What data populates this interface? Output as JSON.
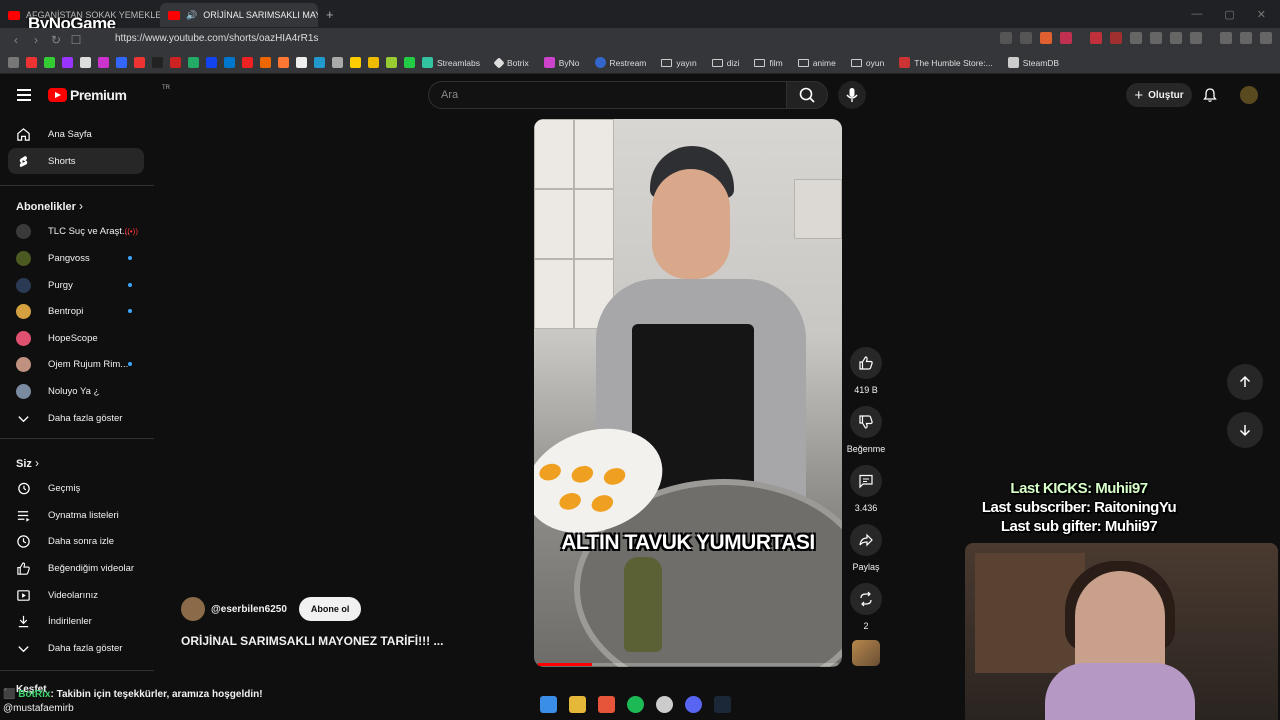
{
  "browser": {
    "tabs": [
      {
        "title": "AFGANİSTAN SOKAK YEMEKLERİNE"
      },
      {
        "title": "ORİJİNAL SARIMSAKLI MAYO"
      }
    ],
    "url": "https://www.youtube.com/shorts/oazHIA4rR1s",
    "brand_overlay": "ByNoGame",
    "bookmarks": [
      "Streamlabs",
      "Botrix",
      "ByNo",
      "Restream",
      "yayın",
      "dizi",
      "film",
      "anime",
      "oyun",
      "The Humble Store:...",
      "SteamDB"
    ]
  },
  "header": {
    "logo_text": "Premium",
    "logo_country": "TR",
    "search_placeholder": "Ara",
    "create_label": "Oluştur"
  },
  "sidebar": {
    "main": [
      {
        "label": "Ana Sayfa",
        "icon": "home-icon"
      },
      {
        "label": "Shorts",
        "icon": "shorts-icon"
      }
    ],
    "subscriptions_title": "Abonelikler",
    "subscriptions": [
      {
        "label": "TLC Suç ve Araşt...",
        "color": "#3a3a3a"
      },
      {
        "label": "Pangvoss",
        "color": "#4a5a20"
      },
      {
        "label": "Purgy",
        "color": "#2a3a55"
      },
      {
        "label": "Bentropi",
        "color": "#d4a040"
      },
      {
        "label": "HopeScope",
        "color": "#e05070"
      },
      {
        "label": "Ojem Rujum Rim...",
        "color": "#c09080"
      },
      {
        "label": "Noluyo Ya ¿",
        "color": "#7a8aa0"
      }
    ],
    "show_more": "Daha fazla göster",
    "you_title": "Siz",
    "you_items": [
      {
        "label": "Geçmiş",
        "icon": "history-icon"
      },
      {
        "label": "Oynatma listeleri",
        "icon": "playlist-icon"
      },
      {
        "label": "Daha sonra izle",
        "icon": "watch-later-icon"
      },
      {
        "label": "Beğendiğim videolar",
        "icon": "liked-icon"
      },
      {
        "label": "Videolarınız",
        "icon": "your-videos-icon"
      },
      {
        "label": "İndirilenler",
        "icon": "download-icon"
      },
      {
        "label": "Daha fazla göster",
        "icon": "chevron-down-icon"
      }
    ],
    "explore_title": "Keşfet"
  },
  "short": {
    "caption": "ALTIN TAVUK YUMURTASI",
    "channel": "@eserbilen6250",
    "subscribe_label": "Abone ol",
    "title": "ORİJİNAL SARIMSAKLI MAYONEZ TARİFİ!!! ...",
    "progress": 0.18,
    "like_count": "419 B",
    "dislike_label": "Beğenme",
    "comment_count": "3.436",
    "share_label": "Paylaş",
    "remix_count": "2"
  },
  "stream_overlay": {
    "line1": "Last KICKS: Muhii97",
    "line2": "Last subscriber: RaitoningYu",
    "line3": "Last sub gifter: Muhii97"
  },
  "chat": {
    "bot_name": "BotRix",
    "message": ": Takibin için teşekkürler, aramıza hoşgeldin!",
    "mention": "@mustafaemirb"
  },
  "colors": {
    "accent": "#ff0000",
    "subscription_dot": "#3ea6ff",
    "overlay_kicks": "#d7ffc9"
  }
}
